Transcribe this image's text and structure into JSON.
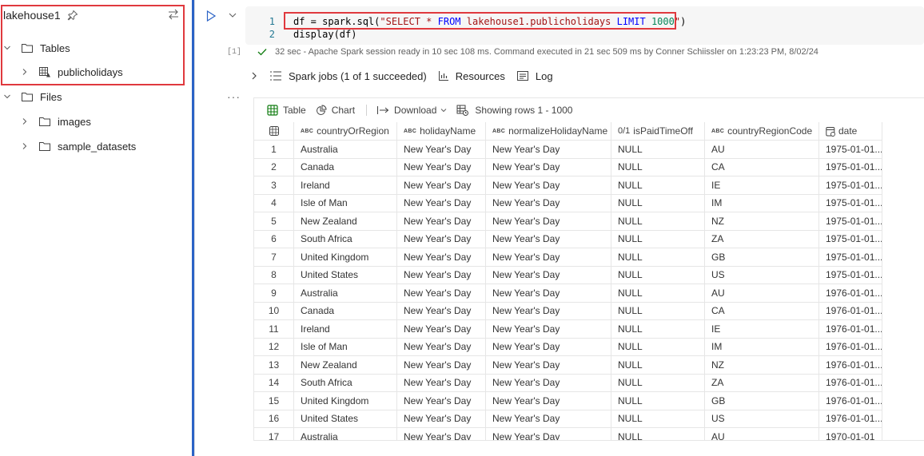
{
  "explorer": {
    "title": "lakehouse1",
    "tables_label": "Tables",
    "table_item": "publicholidays",
    "files_label": "Files",
    "folders": [
      "images",
      "sample_datasets"
    ]
  },
  "cell": {
    "code_lines": [
      {
        "num": "1",
        "segments": [
          {
            "t": "df = spark.sql(",
            "c": ""
          },
          {
            "t": "\"SELECT ",
            "c": "str"
          },
          {
            "t": "* ",
            "c": "str"
          },
          {
            "t": "FROM ",
            "c": "kw"
          },
          {
            "t": "lakehouse1.publicholidays ",
            "c": "str"
          },
          {
            "t": "LIMIT ",
            "c": "kw"
          },
          {
            "t": "1000",
            "c": "num"
          },
          {
            "t": "\"",
            "c": "str"
          },
          {
            "t": ")",
            "c": ""
          }
        ]
      },
      {
        "num": "2",
        "segments": [
          {
            "t": "display(df)",
            "c": ""
          }
        ]
      }
    ],
    "exec_count": "[1]",
    "status": "32 sec - Apache Spark session ready in 10 sec 108 ms. Command executed in 21 sec 509 ms by Conner Schiissler on 1:23:23 PM, 8/02/24",
    "spark_jobs": "Spark jobs (1 of 1 succeeded)",
    "resources": "Resources",
    "log": "Log",
    "more": "···"
  },
  "output": {
    "table_tab": "Table",
    "chart_tab": "Chart",
    "download": "Download",
    "showing": "Showing rows 1 - 1000",
    "columns": [
      {
        "type": "ABC",
        "name": "countryOrRegion"
      },
      {
        "type": "ABC",
        "name": "holidayName"
      },
      {
        "type": "ABC",
        "name": "normalizeHolidayName"
      },
      {
        "type": "0/1",
        "name": "isPaidTimeOff"
      },
      {
        "type": "ABC",
        "name": "countryRegionCode"
      },
      {
        "type": "date",
        "name": "date"
      }
    ],
    "rows": [
      [
        "1",
        "Australia",
        "New Year's Day",
        "New Year's Day",
        "NULL",
        "AU",
        "1975-01-01..."
      ],
      [
        "2",
        "Canada",
        "New Year's Day",
        "New Year's Day",
        "NULL",
        "CA",
        "1975-01-01..."
      ],
      [
        "3",
        "Ireland",
        "New Year's Day",
        "New Year's Day",
        "NULL",
        "IE",
        "1975-01-01..."
      ],
      [
        "4",
        "Isle of Man",
        "New Year's Day",
        "New Year's Day",
        "NULL",
        "IM",
        "1975-01-01..."
      ],
      [
        "5",
        "New Zealand",
        "New Year's Day",
        "New Year's Day",
        "NULL",
        "NZ",
        "1975-01-01..."
      ],
      [
        "6",
        "South Africa",
        "New Year's Day",
        "New Year's Day",
        "NULL",
        "ZA",
        "1975-01-01..."
      ],
      [
        "7",
        "United Kingdom",
        "New Year's Day",
        "New Year's Day",
        "NULL",
        "GB",
        "1975-01-01..."
      ],
      [
        "8",
        "United States",
        "New Year's Day",
        "New Year's Day",
        "NULL",
        "US",
        "1975-01-01..."
      ],
      [
        "9",
        "Australia",
        "New Year's Day",
        "New Year's Day",
        "NULL",
        "AU",
        "1976-01-01..."
      ],
      [
        "10",
        "Canada",
        "New Year's Day",
        "New Year's Day",
        "NULL",
        "CA",
        "1976-01-01..."
      ],
      [
        "11",
        "Ireland",
        "New Year's Day",
        "New Year's Day",
        "NULL",
        "IE",
        "1976-01-01..."
      ],
      [
        "12",
        "Isle of Man",
        "New Year's Day",
        "New Year's Day",
        "NULL",
        "IM",
        "1976-01-01..."
      ],
      [
        "13",
        "New Zealand",
        "New Year's Day",
        "New Year's Day",
        "NULL",
        "NZ",
        "1976-01-01..."
      ],
      [
        "14",
        "South Africa",
        "New Year's Day",
        "New Year's Day",
        "NULL",
        "ZA",
        "1976-01-01..."
      ],
      [
        "15",
        "United Kingdom",
        "New Year's Day",
        "New Year's Day",
        "NULL",
        "GB",
        "1976-01-01..."
      ],
      [
        "16",
        "United States",
        "New Year's Day",
        "New Year's Day",
        "NULL",
        "US",
        "1976-01-01..."
      ],
      [
        "17",
        "Australia",
        "New Year's Day",
        "New Year's Day",
        "NULL",
        "AU",
        "1970-01-01"
      ]
    ]
  },
  "colors": {
    "highlight_box": "#e0393e",
    "divider": "#2b63c6",
    "keyword": "#0000ff",
    "string": "#a31515",
    "number": "#098658",
    "success": "#107c10"
  }
}
